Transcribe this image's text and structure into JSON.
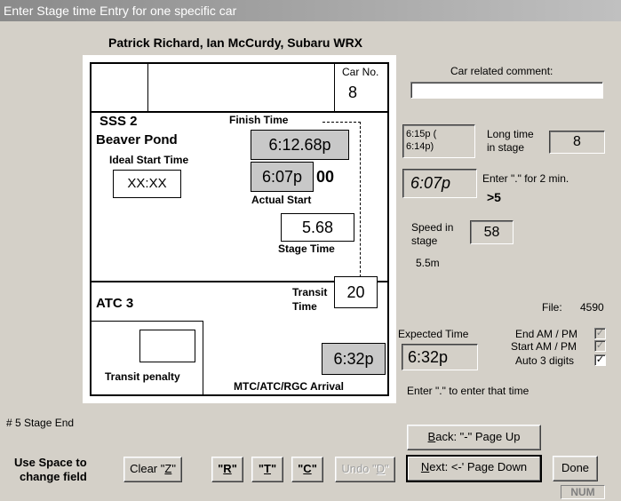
{
  "window": {
    "title": "Enter Stage time Entry for one specific car"
  },
  "header": {
    "crew": "Patrick Richard, Ian McCurdy, Subaru WRX"
  },
  "car": {
    "label": "Car No.",
    "number": "8"
  },
  "stage": {
    "name": "SSS 2",
    "location": "Beaver Pond",
    "ideal_start_label": "Ideal Start Time",
    "ideal_start_value": "XX:XX",
    "finish_label": "Finish Time",
    "finish_value": "6:12.68p",
    "actual_start_value": "6:07p",
    "actual_start_seconds": "00",
    "actual_start_label": "Actual Start",
    "stage_time_value": "5.68",
    "stage_time_label": "Stage Time"
  },
  "atc": {
    "name": "ATC 3",
    "transit_label_1": "Transit",
    "transit_label_2": "Time",
    "transit_value": "20",
    "penalty_label": "Transit penalty",
    "arrival_value": "6:32p",
    "arrival_label": "MTC/ATC/RGC Arrival"
  },
  "right": {
    "comment_label": "Car related comment:",
    "comment_value": "",
    "time_info_1": "6:15p (",
    "time_info_2": "6:14p)",
    "long_time_label_1": "Long time",
    "long_time_label_2": "in stage",
    "long_time_value": "8",
    "current_time": "6:07p",
    "enter_hint": "Enter \".\" for 2 min.",
    "gt_five": ">5",
    "speed_label_1": "Speed in",
    "speed_label_2": "stage",
    "speed_value": "58",
    "distance": "5.5m",
    "file_label": "File:",
    "file_value": "4590",
    "expected_label": "Expected Time",
    "expected_value": "6:32p",
    "end_ampm": "End AM / PM",
    "start_ampm": "Start AM / PM",
    "auto3": "Auto 3 digits",
    "enter_that_time": "Enter \".\" to enter that time"
  },
  "footer": {
    "stage_end": "# 5  Stage End",
    "space_hint_1": "Use Space to",
    "space_hint_2": "change field",
    "status": "NUM"
  },
  "buttons": {
    "clear_pre": "Clear \"",
    "clear_key": "Z",
    "clear_post": "\"",
    "r_pre": "\"",
    "r_key": "R",
    "r_post": "\"",
    "t_pre": "\"",
    "t_key": "T",
    "t_post": "\"",
    "c_pre": "\"",
    "c_key": "C",
    "c_post": "\"",
    "undo_pre": "Undo \"",
    "undo_key": "D",
    "undo_post": "\"",
    "back_pre": "",
    "back_key": "B",
    "back_post": "ack: \"-\" Page Up",
    "next_pre": "",
    "next_key": "N",
    "next_post": "ext: <-' Page Down",
    "done_label": "Done"
  }
}
